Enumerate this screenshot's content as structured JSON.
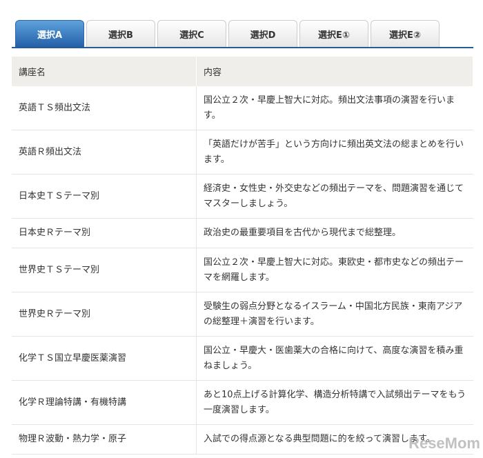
{
  "tabs": [
    {
      "label": "選択A",
      "active": true
    },
    {
      "label": "選択B"
    },
    {
      "label": "選択C"
    },
    {
      "label": "選択D"
    },
    {
      "label": "選択E①"
    },
    {
      "label": "選択E②"
    }
  ],
  "table": {
    "headers": [
      "講座名",
      "内容"
    ],
    "rows": [
      {
        "name": "英語ＴＳ頻出文法",
        "content": "国公立２次・早慶上智大に対応。頻出文法事項の演習を行います。"
      },
      {
        "name": "英語Ｒ頻出文法",
        "content": "「英語だけが苦手」という方向けに頻出英文法の総まとめを行います。"
      },
      {
        "name": "日本史ＴＳテーマ別",
        "content": "経済史・女性史・外交史などの頻出テーマを、問題演習を通じてマスターしましょう。"
      },
      {
        "name": "日本史Ｒテーマ別",
        "content": "政治史の最重要項目を古代から現代まで総整理。"
      },
      {
        "name": "世界史ＴＳテーマ別",
        "content": "国公立２次・早慶上智大に対応。東欧史・都市史などの頻出テーマを網羅します。"
      },
      {
        "name": "世界史Ｒテーマ別",
        "content": "受験生の弱点分野となるイスラーム・中国北方民族・東南アジアの総整理＋演習を行います。"
      },
      {
        "name": "化学ＴＳ国立早慶医薬演習",
        "content": "国公立・早慶大・医歯薬大の合格に向けて、高度な演習を積み重ねましょう。"
      },
      {
        "name": "化学Ｒ理論特講・有機特講",
        "content": "あと10点上げる計算化学、構造分析特講で入試頻出テーマをもう一度演習します。"
      },
      {
        "name": "物理Ｒ波動・熱力学・原子",
        "content": "入試での得点源となる典型問題に的を絞って演習します。"
      }
    ]
  },
  "watermark": "ReseMom"
}
